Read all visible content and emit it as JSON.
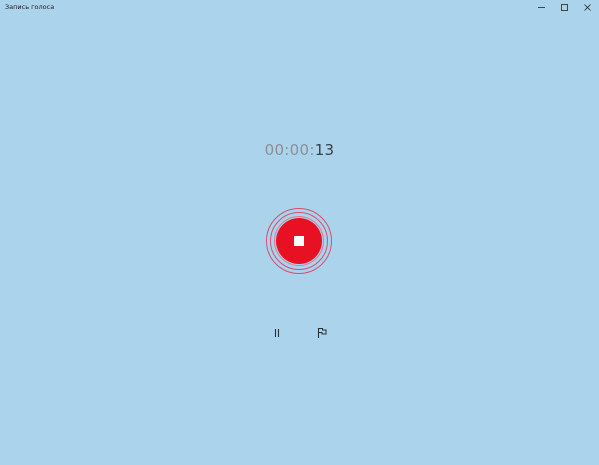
{
  "window": {
    "title": "Запись голоса",
    "controls": {
      "minimize_icon": "minimize-icon",
      "maximize_icon": "maximize-icon",
      "close_icon": "close-icon"
    }
  },
  "recorder": {
    "timer_prefix": "00:00:",
    "timer_seconds": "13",
    "stop_icon": "stop-icon",
    "pause_icon": "pause-icon",
    "marker_icon": "flag-icon"
  },
  "colors": {
    "background": "#acd3ec",
    "record_accent": "#e81123"
  }
}
